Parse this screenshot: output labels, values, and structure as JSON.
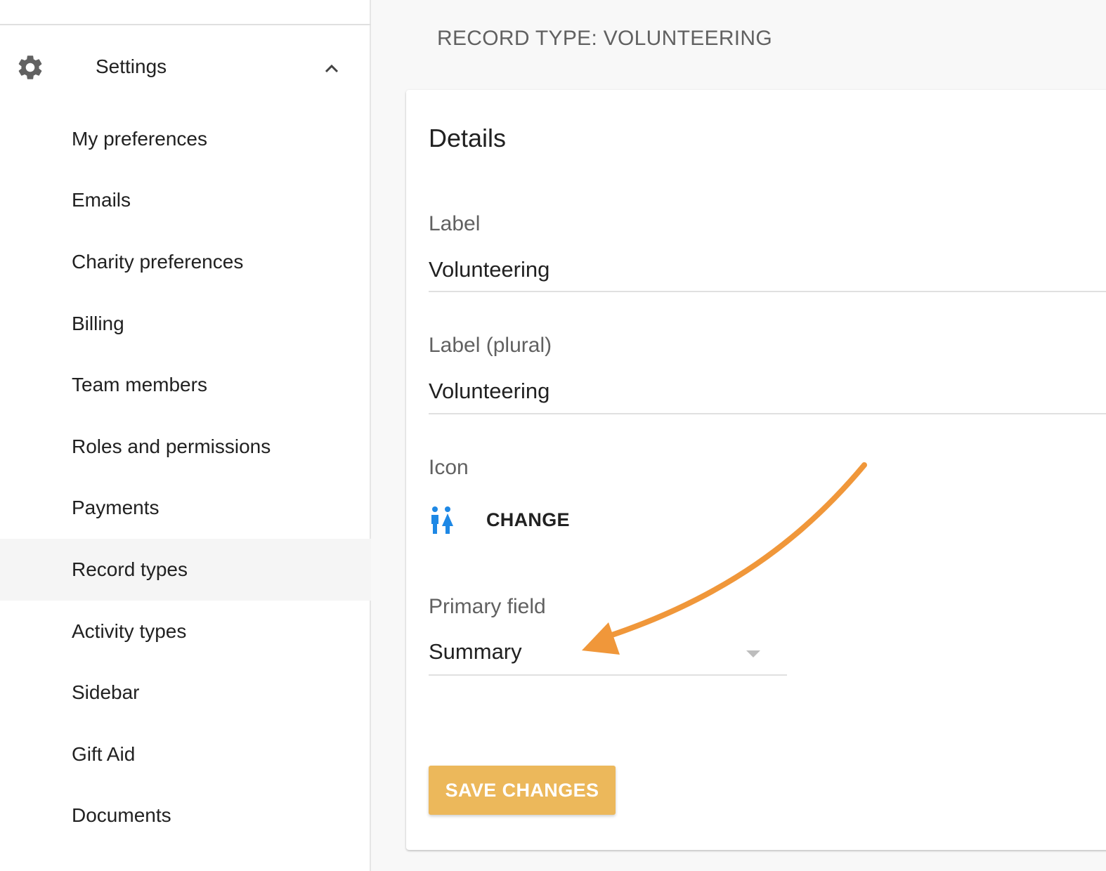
{
  "sidebar": {
    "settings_label": "Settings",
    "items": [
      {
        "label": "My preferences",
        "active": false
      },
      {
        "label": "Emails",
        "active": false
      },
      {
        "label": "Charity preferences",
        "active": false
      },
      {
        "label": "Billing",
        "active": false
      },
      {
        "label": "Team members",
        "active": false
      },
      {
        "label": "Roles and permissions",
        "active": false
      },
      {
        "label": "Payments",
        "active": false
      },
      {
        "label": "Record types",
        "active": true
      },
      {
        "label": "Activity types",
        "active": false
      },
      {
        "label": "Sidebar",
        "active": false
      },
      {
        "label": "Gift Aid",
        "active": false
      },
      {
        "label": "Documents",
        "active": false
      }
    ]
  },
  "main": {
    "page_title": "RECORD TYPE: VOLUNTEERING",
    "card": {
      "title": "Details",
      "label_field": {
        "label": "Label",
        "value": "Volunteering"
      },
      "label_plural_field": {
        "label": "Label (plural)",
        "value": "Volunteering"
      },
      "icon_field": {
        "label": "Icon",
        "icon_name": "people-icon",
        "change_label": "CHANGE"
      },
      "primary_field": {
        "label": "Primary field",
        "value": "Summary"
      },
      "save_label": "SAVE CHANGES"
    }
  },
  "colors": {
    "accent_button": "#ecb85b",
    "icon_blue": "#1e88e5",
    "annotation_arrow": "#f0973a",
    "active_nav_bg": "#f5f5f5"
  }
}
